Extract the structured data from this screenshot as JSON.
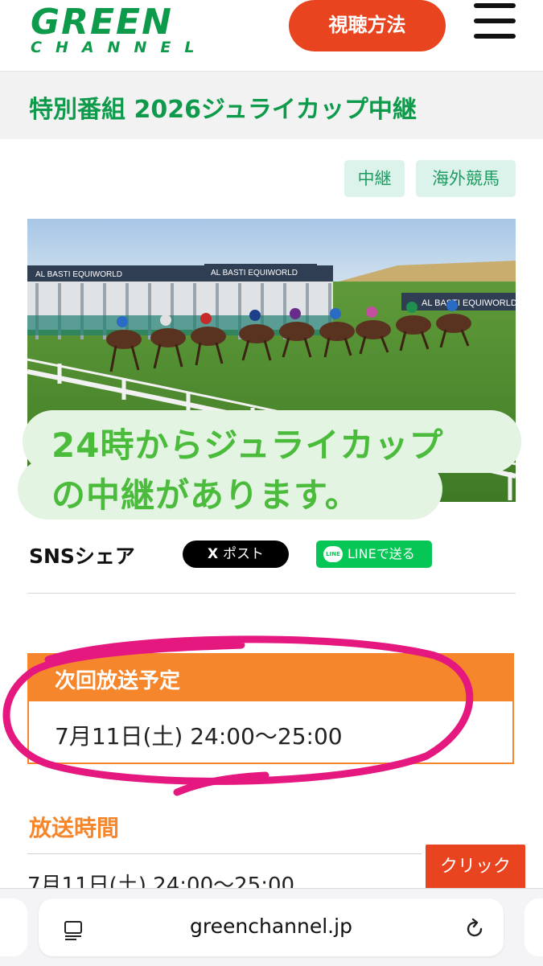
{
  "header": {
    "logo_top": "GREEN",
    "logo_bottom": "CHANNEL",
    "watch_button": "視聴方法",
    "menu_icon": "hamburger-menu-icon"
  },
  "page": {
    "title": "特別番組 2026ジュライカップ中継",
    "tags": [
      "中継",
      "海外競馬"
    ]
  },
  "hero": {
    "banner_brand": "AL BASTI EQUIWORLD",
    "overlay_line1": "24時からジュライカップ",
    "overlay_line2": "の中継があります。"
  },
  "sns": {
    "label": "SNSシェア",
    "x_button": "ポスト",
    "x_icon": "X",
    "line_button": "LINEで送る",
    "line_icon": "LINE"
  },
  "next_broadcast": {
    "heading": "次回放送予定",
    "time": "7月11日(土) 24:00～25:00"
  },
  "broadcast_time": {
    "heading": "放送時間",
    "row": "7月11日(土) 24:00～25:00",
    "click_button": "クリック"
  },
  "browser": {
    "url": "greenchannel.jp",
    "reader_icon": "reader-mode-icon",
    "reload_icon": "reload-icon"
  },
  "colors": {
    "brand_green": "#0e9a4b",
    "accent_orange": "#f5862b",
    "cta_red": "#e8441f",
    "overlay_green": "#4bbb3c",
    "annotation_pink": "#e5187f"
  }
}
